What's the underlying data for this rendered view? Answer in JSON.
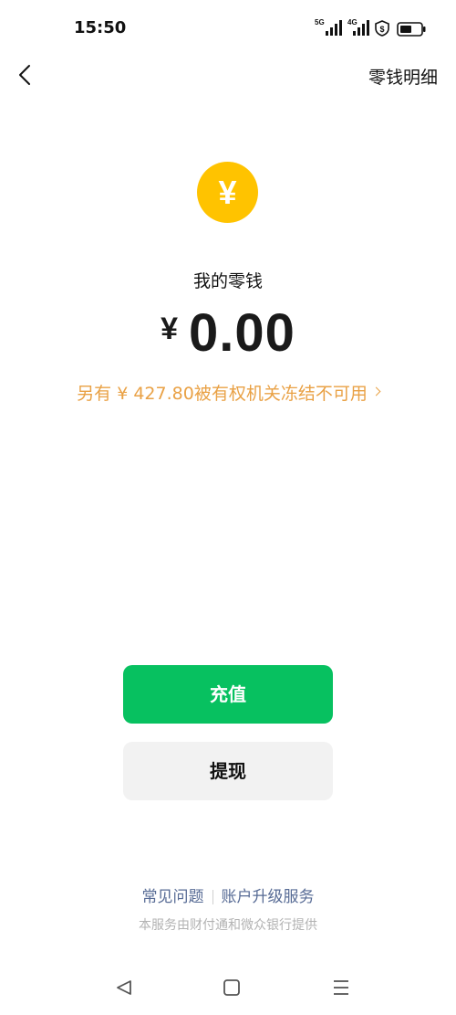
{
  "status_bar": {
    "time": "15:50",
    "signal_1_label": "5G",
    "signal_2_label": "4G",
    "icons": [
      "signal-5g-icon",
      "signal-4g-icon",
      "shield-icon",
      "battery-icon"
    ]
  },
  "nav": {
    "back_icon": "chevron-left-icon",
    "detail_label": "零钱明细"
  },
  "balance": {
    "coin_glyph": "¥",
    "title": "我的零钱",
    "currency": "¥",
    "amount": "0.00",
    "frozen_notice": "另有 ¥ 427.80被有权机关冻结不可用"
  },
  "actions": {
    "recharge_label": "充值",
    "withdraw_label": "提现"
  },
  "footer": {
    "faq_label": "常见问题",
    "upgrade_label": "账户升级服务",
    "provider_text": "本服务由财付通和微众银行提供"
  },
  "colors": {
    "coin": "#ffc300",
    "primary_button": "#07c160",
    "secondary_button": "#f2f2f2",
    "frozen_text": "#e9a145",
    "link": "#576b95",
    "muted": "#b2b2b2"
  }
}
